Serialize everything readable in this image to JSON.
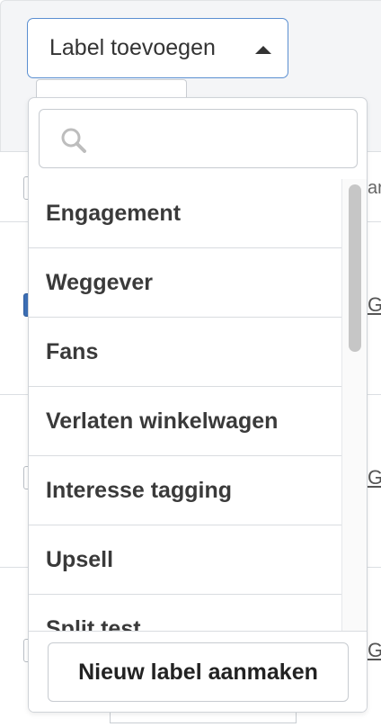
{
  "trigger": {
    "label": "Label toevoegen"
  },
  "search": {
    "placeholder": "",
    "value": ""
  },
  "labels": [
    "Engagement",
    "Weggever",
    "Fans",
    "Verlaten winkelwagen",
    "Interesse tagging",
    "Upsell",
    "Split test"
  ],
  "footer": {
    "create_label": "Nieuw label aanmaken"
  },
  "background": {
    "column_stub": "ar",
    "row_links": [
      "G",
      "G",
      "G"
    ]
  },
  "colors": {
    "accent_border": "#5b8fd1",
    "checked": "#3d6fb6"
  }
}
